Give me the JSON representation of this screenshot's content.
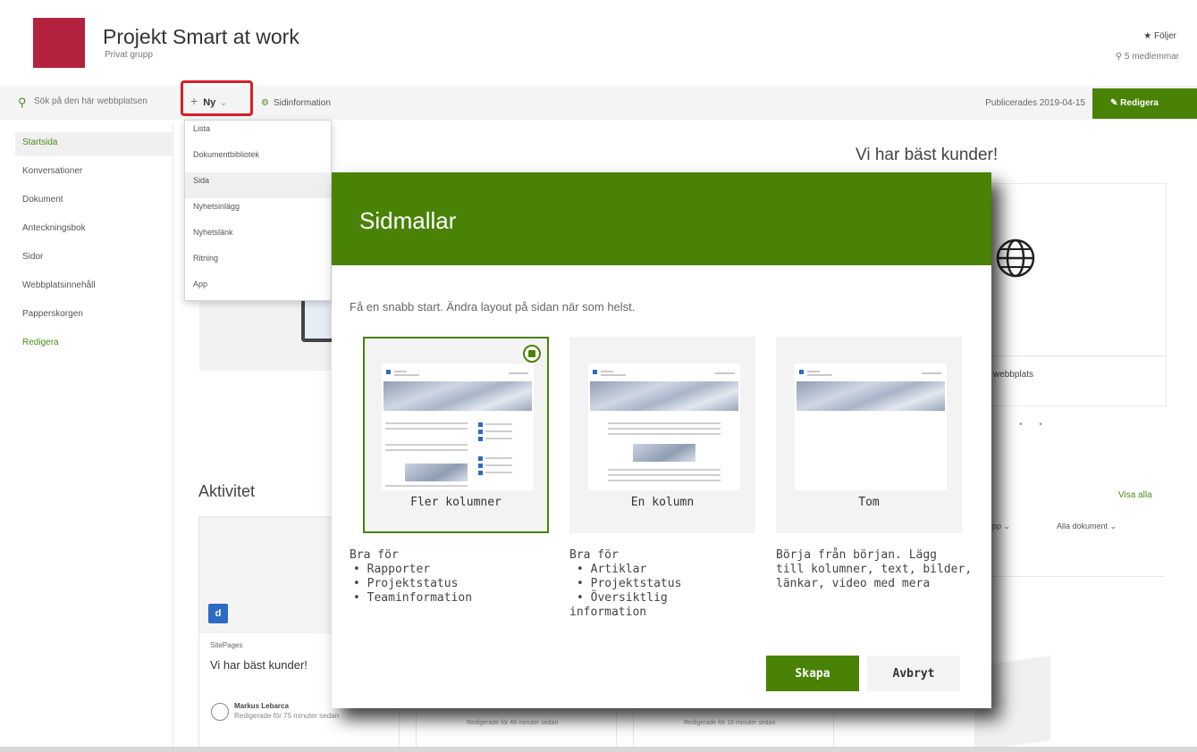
{
  "site": {
    "title": "Projekt Smart at work",
    "subtitle": "Privat grupp",
    "follow": "★ Följer",
    "members": "⚲ 5 medlemmar",
    "logo_color": "#b3223f"
  },
  "commandbar": {
    "search_placeholder": "Sök på den här webbplatsen",
    "new_label": "Ny",
    "page_info": "Sidinformation",
    "published": "Publicerades 2019-04-15",
    "edit": "Redigera"
  },
  "leftnav": {
    "items": [
      "Startsida",
      "Konversationer",
      "Dokument",
      "Anteckningsbok",
      "Sidor",
      "Webbplatsinnehåll",
      "Papperskorgen",
      "Redigera"
    ]
  },
  "new_menu": {
    "items": [
      "Lista",
      "Dokumentbibliotek",
      "Sida",
      "Nyhetsinlägg",
      "Nyhetslänk",
      "Ritning",
      "App"
    ]
  },
  "background": {
    "right_title": "Vi har bäst kunder!",
    "right_card_text": "webbplats",
    "view_all": "Visa alla",
    "library_filter": "pp ⌄",
    "all_docs": "Alla dokument ⌄",
    "activity_title": "Aktivitet",
    "activity_library": "SitePages",
    "activity_item": "Vi har bäst kunder!",
    "activity_person": "Markus Lebarca",
    "activity_edited": "Redigerade för 75 minuter sedan",
    "activity2": "Redigerade för 48 minuter sedan",
    "activity3": "Redigerade för 18 minuter sedan"
  },
  "modal": {
    "title": "Sidmallar",
    "description": "Få en snabb start. Ändra layout på sidan när som helst.",
    "templates": [
      {
        "name": "Fler kolumner",
        "selected": true
      },
      {
        "name": "En kolumn",
        "selected": false
      },
      {
        "name": "Tom",
        "selected": false
      }
    ],
    "desc1": {
      "head": "Bra för",
      "items": [
        "• Rapporter",
        "• Projektstatus",
        "• Teaminformation"
      ]
    },
    "desc2": {
      "head": "Bra för",
      "items": [
        "• Artiklar",
        "• Projektstatus",
        "• Översiktlig",
        "information"
      ]
    },
    "desc3": {
      "lines": [
        "Börja från början. Lägg",
        "till kolumner, text, bilder,",
        "länkar, video med mera"
      ]
    },
    "create": "Skapa",
    "cancel": "Avbryt"
  },
  "colors": {
    "accent_green": "#498205",
    "highlight_red": "#d61e26"
  }
}
